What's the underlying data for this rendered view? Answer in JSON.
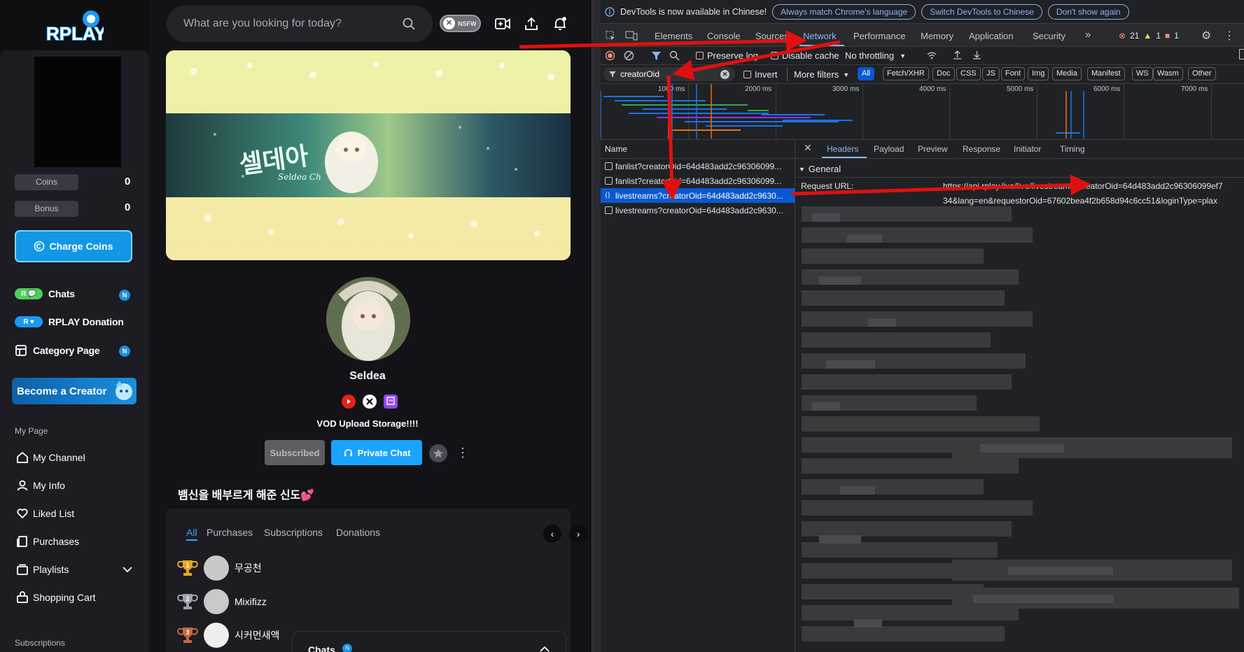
{
  "rplay": {
    "logo_text": "RPLAY",
    "sidebar": {
      "coins_label": "Coins",
      "coins_value": "0",
      "bonus_label": "Bonus",
      "bonus_value": "0",
      "charge_button": "Charge Coins",
      "nav": [
        {
          "label": "Chats",
          "badge": "N",
          "icon": "chat-tag-icon"
        },
        {
          "label": "RPLAY Donation",
          "icon": "donation-tag-icon"
        },
        {
          "label": "Category Page",
          "badge": "N",
          "icon": "category-icon"
        }
      ],
      "become_creator": "Become a Creator",
      "my_page_section": "My Page",
      "my_page_items": [
        "My Channel",
        "My Info",
        "Liked List",
        "Purchases",
        "Playlists",
        "Shopping Cart"
      ],
      "subscriptions_section": "Subscriptions"
    },
    "header": {
      "search_placeholder": "What are you looking for today?",
      "nsfw_label": "NSFW"
    },
    "banner": {
      "title_kr": "셀데아",
      "subtitle": "Seldea Ch"
    },
    "profile": {
      "name": "Seldea",
      "tagline": "VOD Upload Storage!!!!",
      "subscribed_button": "Subscribed",
      "private_chat_button": "Private Chat",
      "board_title": "뱀신을 배부르게 해준 신도💕"
    },
    "ranking": {
      "tabs": [
        "All",
        "Purchases",
        "Subscriptions",
        "Donations"
      ],
      "active_tab": "All",
      "entries": [
        {
          "rank": "1",
          "name": "무공천",
          "trophy_color": "#e5a822"
        },
        {
          "rank": "2",
          "name": "Mixifizz",
          "trophy_color": "#9ea3ab"
        },
        {
          "rank": "3",
          "name": "시커먼새액",
          "trophy_color": "#c46a3a"
        }
      ]
    },
    "chats_popup": {
      "title": "Chats",
      "badge": "N"
    }
  },
  "devtools": {
    "infobar": {
      "message": "DevTools is now available in Chinese!",
      "buttons": [
        "Always match Chrome's language",
        "Switch DevTools to Chinese",
        "Don't show again"
      ]
    },
    "panels": [
      "Elements",
      "Console",
      "Sources",
      "Network",
      "Performance",
      "Memory",
      "Application",
      "Security"
    ],
    "active_panel": "Network",
    "status": {
      "errors": "21",
      "warnings": "1",
      "issues": "1"
    },
    "toolbar": {
      "preserve_log": "Preserve log",
      "disable_cache": "Disable cache",
      "throttling": "No throttling"
    },
    "filter": {
      "value": "creatorOid",
      "invert": "Invert",
      "more_filters": "More filters",
      "chips": [
        "All",
        "Fetch/XHR",
        "Doc",
        "CSS",
        "JS",
        "Font",
        "Img",
        "Media",
        "Manifest",
        "WS",
        "Wasm",
        "Other"
      ],
      "active_chip": "All"
    },
    "timeline_ticks": [
      "1000 ms",
      "2000 ms",
      "3000 ms",
      "4000 ms",
      "5000 ms",
      "6000 ms",
      "7000 ms"
    ],
    "requests": {
      "header": "Name",
      "items": [
        "fanlist?creatorOid=64d483add2c96306099...",
        "fanlist?creatorOid=64d483add2c96306099...",
        "livestreams?creatorOid=64d483add2c9630...",
        "livestreams?creatorOid=64d483add2c9630..."
      ],
      "selected_index": 2
    },
    "detail": {
      "tabs": [
        "Headers",
        "Payload",
        "Preview",
        "Response",
        "Initiator",
        "Timing"
      ],
      "active_tab": "Headers",
      "section": "General",
      "request_url_label": "Request URL:",
      "request_url_line1": "https://api.rplay.live/live/livestreams?creatorOid=64d483add2c96306099ef7",
      "request_url_line2": "34&lang=en&requestorOid=67602bea4f2b658d94c6cc51&loginType=plax"
    }
  },
  "colors": {
    "accent_blue": "#1aa3ff",
    "devtools_selected": "#0b57d0",
    "annotation_red": "#e01010"
  }
}
